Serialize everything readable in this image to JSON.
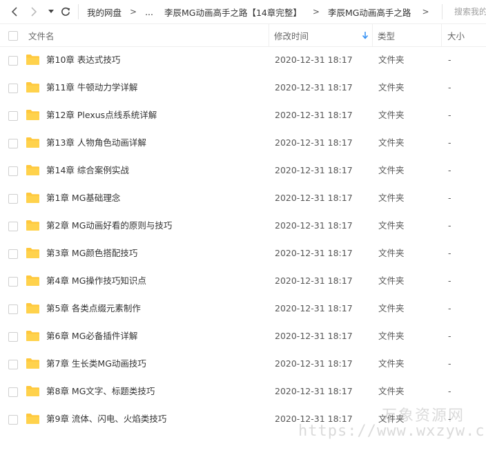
{
  "nav": {
    "back_icon": "chevron-left-icon",
    "forward_icon": "chevron-right-icon",
    "dropdown_icon": "caret-down-icon",
    "refresh_icon": "refresh-icon"
  },
  "breadcrumb": {
    "root": "我的网盘",
    "ellipsis": "...",
    "parent": "李辰MG动画高手之路【14章完整】",
    "current": "李辰MG动画高手之路",
    "separator": ">"
  },
  "search": {
    "placeholder": "搜索我的网盘文件"
  },
  "columns": {
    "name": "文件名",
    "modified": "修改时间",
    "type": "类型",
    "size": "大小"
  },
  "colors": {
    "folder": "#FFC83D",
    "sort_arrow": "#2f8ef4",
    "border": "#eeeeee"
  },
  "files": [
    {
      "name": "第10章 表达式技巧",
      "modified": "2020-12-31 18:17",
      "type": "文件夹",
      "size": "-"
    },
    {
      "name": "第11章 牛顿动力学详解",
      "modified": "2020-12-31 18:17",
      "type": "文件夹",
      "size": "-"
    },
    {
      "name": "第12章 Plexus点线系统详解",
      "modified": "2020-12-31 18:17",
      "type": "文件夹",
      "size": "-"
    },
    {
      "name": "第13章 人物角色动画详解",
      "modified": "2020-12-31 18:17",
      "type": "文件夹",
      "size": "-"
    },
    {
      "name": "第14章 综合案例实战",
      "modified": "2020-12-31 18:17",
      "type": "文件夹",
      "size": "-"
    },
    {
      "name": "第1章 MG基础理念",
      "modified": "2020-12-31 18:17",
      "type": "文件夹",
      "size": "-"
    },
    {
      "name": "第2章 MG动画好看的原则与技巧",
      "modified": "2020-12-31 18:17",
      "type": "文件夹",
      "size": "-"
    },
    {
      "name": "第3章 MG颜色搭配技巧",
      "modified": "2020-12-31 18:17",
      "type": "文件夹",
      "size": "-"
    },
    {
      "name": "第4章 MG操作技巧知识点",
      "modified": "2020-12-31 18:17",
      "type": "文件夹",
      "size": "-"
    },
    {
      "name": "第5章 各类点缀元素制作",
      "modified": "2020-12-31 18:17",
      "type": "文件夹",
      "size": "-"
    },
    {
      "name": "第6章 MG必备插件详解",
      "modified": "2020-12-31 18:17",
      "type": "文件夹",
      "size": "-"
    },
    {
      "name": "第7章 生长类MG动画技巧",
      "modified": "2020-12-31 18:17",
      "type": "文件夹",
      "size": "-"
    },
    {
      "name": "第8章 MG文字、标题类技巧",
      "modified": "2020-12-31 18:17",
      "type": "文件夹",
      "size": "-"
    },
    {
      "name": "第9章 流体、闪电、火焰类技巧",
      "modified": "2020-12-31 18:17",
      "type": "文件夹",
      "size": "-"
    }
  ],
  "watermark": {
    "title": "万象资源网",
    "url": "https://www.wxzyw.cn"
  }
}
